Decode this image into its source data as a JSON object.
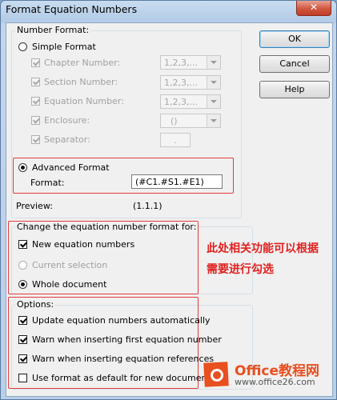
{
  "window": {
    "title": "Format Equation Numbers",
    "close_glyph": "✕"
  },
  "buttons": {
    "ok": "OK",
    "cancel": "Cancel",
    "help": "Help"
  },
  "number_format": {
    "group_label": "Number Format:",
    "simple_format": {
      "label": "Simple Format",
      "selected": false
    },
    "rows": [
      {
        "label": "Chapter Number:",
        "value": "1,2,3,..."
      },
      {
        "label": "Section Number:",
        "value": "1,2,3,..."
      },
      {
        "label": "Equation Number:",
        "value": "1,2,3,..."
      },
      {
        "label": "Enclosure:",
        "value": "()"
      },
      {
        "label": "Separator:",
        "value": "."
      }
    ],
    "advanced_format": {
      "label": "Advanced Format",
      "selected": true
    },
    "format_label": "Format:",
    "format_value": "(#C1.#S1.#E1)",
    "preview_label": "Preview:",
    "preview_value": "(1.1.1)"
  },
  "change_for": {
    "group_label": "Change the equation number format for:",
    "new_equations": {
      "label": "New equation numbers",
      "checked": true
    },
    "current_selection": {
      "label": "Current selection",
      "enabled": false
    },
    "whole_document": {
      "label": "Whole document",
      "selected": true
    }
  },
  "options": {
    "group_label": "Options:",
    "items": [
      {
        "label": "Update equation numbers automatically",
        "checked": true
      },
      {
        "label": "Warn when inserting first equation number",
        "checked": true
      },
      {
        "label": "Warn when inserting equation references",
        "checked": true
      },
      {
        "label": "Use format as default for new documents",
        "checked": false
      }
    ]
  },
  "annotation": {
    "line1": "此处相关功能可以根据",
    "line2": "需要进行勾选",
    "color": "#e02020"
  },
  "watermark": {
    "brand": "Office教程网",
    "url": "www.office26.com",
    "color": "#e8501f"
  }
}
